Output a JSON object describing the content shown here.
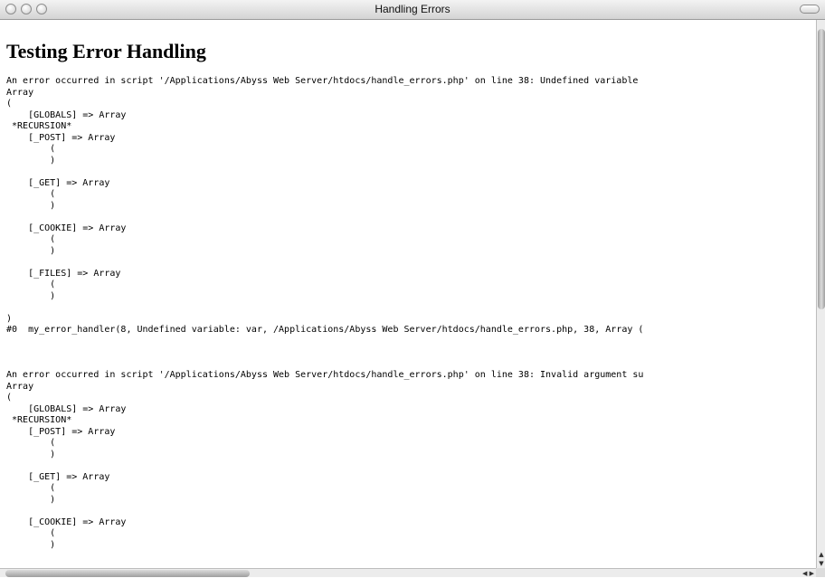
{
  "window": {
    "title": "Handling Errors"
  },
  "page": {
    "heading": "Testing Error Handling",
    "log_text": "An error occurred in script '/Applications/Abyss Web Server/htdocs/handle_errors.php' on line 38: Undefined variable\nArray\n(\n    [GLOBALS] => Array\n *RECURSION*\n    [_POST] => Array\n        (\n        )\n\n    [_GET] => Array\n        (\n        )\n\n    [_COOKIE] => Array\n        (\n        )\n\n    [_FILES] => Array\n        (\n        )\n\n)\n#0  my_error_handler(8, Undefined variable: var, /Applications/Abyss Web Server/htdocs/handle_errors.php, 38, Array (\n\n\n\nAn error occurred in script '/Applications/Abyss Web Server/htdocs/handle_errors.php' on line 38: Invalid argument su\nArray\n(\n    [GLOBALS] => Array\n *RECURSION*\n    [_POST] => Array\n        (\n        )\n\n    [_GET] => Array\n        (\n        )\n\n    [_COOKIE] => Array\n        (\n        )"
  },
  "icons": {
    "close": "close-button",
    "minimize": "minimize-button",
    "zoom": "zoom-button",
    "toolbar_toggle": "toolbar-toggle-button",
    "scroll_up": "▲",
    "scroll_down": "▼",
    "scroll_left": "◀",
    "scroll_right": "▶"
  }
}
